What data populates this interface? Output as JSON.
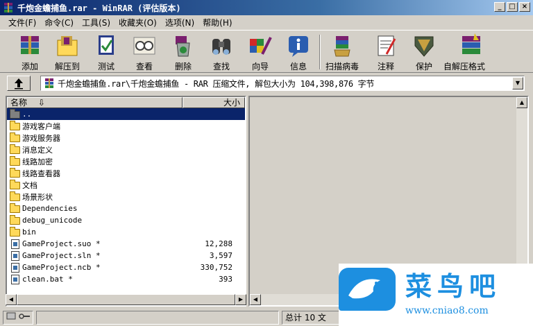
{
  "window": {
    "title": "千炮金蟾捕鱼.rar - WinRAR (评估版本)",
    "controls": [
      "_",
      "□",
      "×"
    ]
  },
  "menu": [
    "文件(F)",
    "命令(C)",
    "工具(S)",
    "收藏夹(O)",
    "选项(N)",
    "帮助(H)"
  ],
  "toolbar": {
    "buttons": [
      {
        "label": "添加",
        "icon": "add-icon"
      },
      {
        "label": "解压到",
        "icon": "extract-icon"
      },
      {
        "label": "测试",
        "icon": "test-icon"
      },
      {
        "label": "查看",
        "icon": "view-icon"
      },
      {
        "label": "删除",
        "icon": "delete-icon"
      },
      {
        "label": "查找",
        "icon": "find-icon"
      },
      {
        "label": "向导",
        "icon": "wizard-icon"
      },
      {
        "label": "信息",
        "icon": "info-icon"
      },
      {
        "label": "扫描病毒",
        "icon": "virus-scan-icon"
      },
      {
        "label": "注释",
        "icon": "comment-icon"
      },
      {
        "label": "保护",
        "icon": "protect-icon"
      },
      {
        "label": "自解压格式",
        "icon": "sfx-icon"
      }
    ]
  },
  "address": {
    "path": "千炮金蟾捕鱼.rar\\千炮金蟾捕鱼 - RAR 压缩文件, 解包大小为 104,398,876 字节"
  },
  "list": {
    "col_name": "名称",
    "col_size": "大小",
    "rows": [
      {
        "name": "..",
        "size": "",
        "type": "parent",
        "selected": true
      },
      {
        "name": "游戏客户端",
        "size": "",
        "type": "folder"
      },
      {
        "name": "游戏服务器",
        "size": "",
        "type": "folder"
      },
      {
        "name": "消息定义",
        "size": "",
        "type": "folder"
      },
      {
        "name": "线路加密",
        "size": "",
        "type": "folder"
      },
      {
        "name": "线路查看器",
        "size": "",
        "type": "folder"
      },
      {
        "name": "文档",
        "size": "",
        "type": "folder"
      },
      {
        "name": "场景形状",
        "size": "",
        "type": "folder"
      },
      {
        "name": "Dependencies",
        "size": "",
        "type": "folder"
      },
      {
        "name": "debug_unicode",
        "size": "",
        "type": "folder"
      },
      {
        "name": "bin",
        "size": "",
        "type": "folder"
      },
      {
        "name": "GameProject.suo *",
        "size": "12,288",
        "type": "file"
      },
      {
        "name": "GameProject.sln *",
        "size": "3,597",
        "type": "file"
      },
      {
        "name": "GameProject.ncb *",
        "size": "330,752",
        "type": "file"
      },
      {
        "name": "clean.bat *",
        "size": "393",
        "type": "file"
      }
    ]
  },
  "status": {
    "total": "总计 10 文"
  },
  "watermark": {
    "brand": "菜鸟吧",
    "url": "www.cniao8.com"
  },
  "colors": {
    "title_start": "#0a246a",
    "title_end": "#a6caf0",
    "selection": "#0a246a",
    "face": "#d4d0c8",
    "watermark": "#1d8fe0"
  }
}
